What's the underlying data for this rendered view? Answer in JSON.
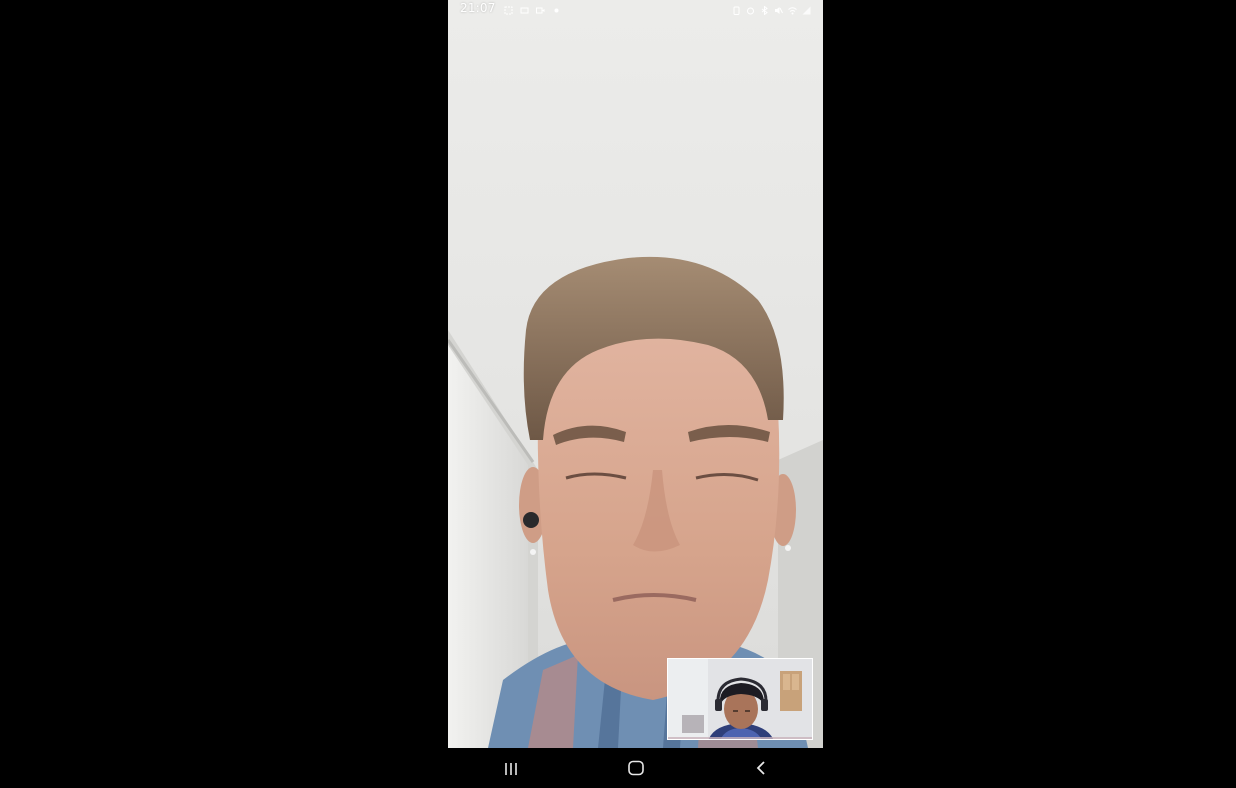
{
  "status_bar": {
    "time": "21:07",
    "left_icons": [
      "screen-record-icon",
      "cast-icon",
      "video-camera-icon",
      "dot-indicator-icon"
    ],
    "right_icons": [
      "battery-saver-icon",
      "alarm-icon",
      "bluetooth-icon",
      "mute-icon",
      "wifi-icon",
      "signal-icon"
    ]
  },
  "call": {
    "remote_video": "remote-participant-video",
    "self_view": "local-camera-preview"
  },
  "nav_bar": {
    "buttons": [
      "recent-apps-icon",
      "home-icon",
      "back-icon"
    ]
  },
  "colors": {
    "background": "#000000",
    "wall": "#e6e6e4",
    "skin": "#d9a98f",
    "hair": "#8a7058",
    "shirt_blue": "#5f7fa5",
    "shirt_red": "#b98a86"
  }
}
